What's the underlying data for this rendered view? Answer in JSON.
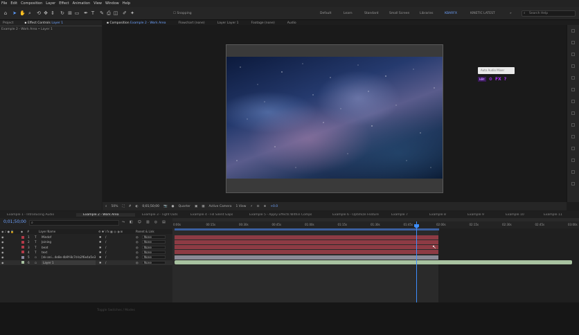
{
  "menu": [
    "File",
    "Edit",
    "Composition",
    "Layer",
    "Effect",
    "Animation",
    "View",
    "Window",
    "Help"
  ],
  "toolbar": {
    "snapping": "Snapping",
    "workspaces": [
      "Default",
      "Learn",
      "Standard",
      "Small Screen",
      "Libraries",
      "KBARFX",
      "KINETIC LATEST"
    ],
    "active_workspace": "KBARFX",
    "search_placeholder": "Search Help"
  },
  "left_panel": {
    "tabs": [
      "Project",
      "Effect Controls"
    ],
    "effect_controls_target": "Layer 1",
    "breadcrumb": "Example 2 - Work Area • Layer 1"
  },
  "comp_panel": {
    "tabs": [
      {
        "label": "Composition",
        "target": "Example 2 - Work Area"
      },
      {
        "label": "Flowchart",
        "target": "(none)"
      },
      {
        "label": "Layer",
        "target": "Layer 1"
      },
      {
        "label": "Footage",
        "target": "(none)"
      },
      {
        "label": "Audio",
        "target": ""
      }
    ],
    "subtab": "Example 2 - Work Area"
  },
  "overlay": {
    "popup_label": "Auto Audio Mixer",
    "buttons": [
      "kBt",
      "⚙",
      "FX",
      "?"
    ]
  },
  "viewer": {
    "zoom": "50%",
    "timecode": "0;01;50;00",
    "resolution": "Quarter",
    "camera": "Active Camera",
    "views": "1 View",
    "exposure": "+0.0"
  },
  "timeline": {
    "tabs": [
      "Example 1 - Introducing Audio",
      "Example 2 - Work Area",
      "Example 3 - Tight Outs",
      "Example 4 - Fill Silent Gaps",
      "Example 5 - Apply Effects Within Comps",
      "Example 6 - Optimize Feature",
      "Example 7",
      "Example 8",
      "Example 9",
      "Example 10",
      "Example 11"
    ],
    "active_tab": "Example 2 - Work Area",
    "current_time": "0;01;50;00",
    "columns": {
      "name": "Layer Name",
      "parent": "Parent & Link"
    },
    "ruler_ticks": [
      "0:00s",
      "00:15s",
      "00:30s",
      "00:45s",
      "01:00s",
      "01:15s",
      "01:30s",
      "01:45s",
      "02:00s",
      "02:15s",
      "02:30s",
      "02:45s",
      "03:00s"
    ],
    "layers": [
      {
        "num": "1",
        "type": "T",
        "name": "Mindof",
        "parent": "None",
        "color": "#b23a48"
      },
      {
        "num": "2",
        "type": "T",
        "name": "Joining",
        "parent": "None",
        "color": "#b23a48"
      },
      {
        "num": "3",
        "type": "T",
        "name": "beat",
        "parent": "None",
        "color": "#b23a48"
      },
      {
        "num": "4",
        "type": "T",
        "name": "text",
        "parent": "None",
        "color": "#b23a48"
      },
      {
        "num": "5",
        "type": "img",
        "name": "[nk-ani...4e8e-4b9f-8c7d-b2f6e4a5e3f0].jpg",
        "parent": "None",
        "color": "#8a8aa0"
      },
      {
        "num": "6",
        "type": "",
        "name": "Layer 1",
        "parent": "None",
        "color": "#a8c2a0"
      }
    ]
  },
  "bottom_bar": {
    "toggle": "Toggle Switches / Modes"
  }
}
